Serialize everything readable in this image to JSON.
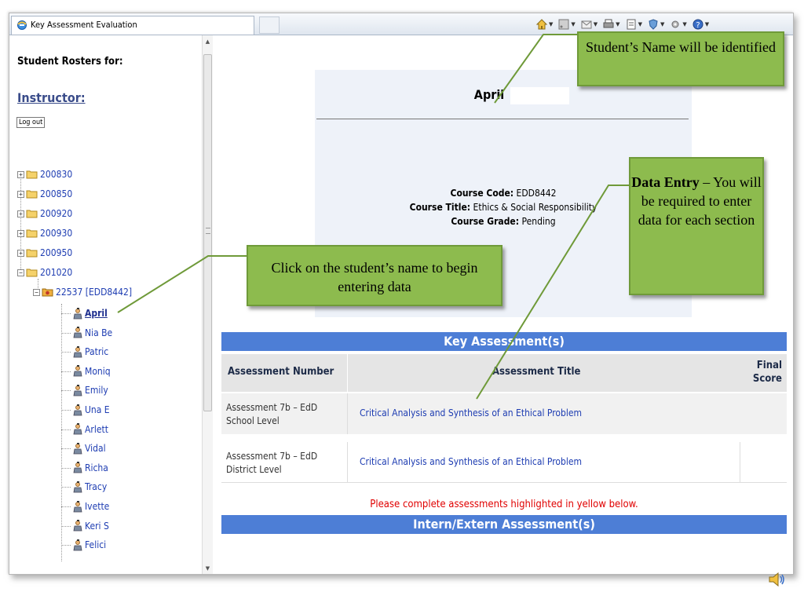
{
  "browser": {
    "tab_title": "Key Assessment Evaluation",
    "toolbar_icons": [
      "home-icon",
      "feeds-icon",
      "mail-icon",
      "print-icon",
      "page-icon",
      "safety-icon",
      "tools-icon",
      "help-icon"
    ]
  },
  "sidebar": {
    "title": "Student Rosters for:",
    "instructor_label": "Instructor:",
    "logout_label": "Log out",
    "terms": [
      {
        "label": "200830",
        "toggle": "+"
      },
      {
        "label": "200850",
        "toggle": "+"
      },
      {
        "label": "200920",
        "toggle": "+"
      },
      {
        "label": "200930",
        "toggle": "+"
      },
      {
        "label": "200950",
        "toggle": "+"
      },
      {
        "label": "201020",
        "toggle": "−"
      }
    ],
    "course": {
      "label": "22537 [EDD8442]",
      "toggle": "−"
    },
    "students": [
      "April",
      "Nia Be",
      "Patric",
      "Moniq",
      "Emily",
      "Una E",
      "Arlett",
      "Vidal",
      "Richa",
      "Tracy",
      "Ivette",
      "Keri S",
      "Felici"
    ]
  },
  "main": {
    "student_name": "April",
    "course_code_label": "Course Code:",
    "course_code": "EDD8442",
    "course_title_label": "Course Title:",
    "course_title": "Ethics & Social Responsibility",
    "course_grade_label": "Course Grade:",
    "course_grade": "Pending",
    "key_assessments_header": "Key Assessment(s)",
    "columns": [
      "Assessment Number",
      "Assessment Title",
      "Final Score"
    ],
    "rows": [
      {
        "number": "Assessment 7b – EdD School Level",
        "title": "Critical Analysis and Synthesis of an Ethical Problem",
        "score": ""
      },
      {
        "number": "Assessment 7b – EdD District Level",
        "title": "Critical Analysis and Synthesis of an Ethical Problem",
        "score": ""
      }
    ],
    "notice": "Please complete assessments highlighted in yellow below.",
    "intern_header": "Intern/Extern Assessment(s)"
  },
  "callouts": {
    "name": "Student’s Name will be identified",
    "click": "Click on the student’s name to begin entering data",
    "data_bold": "Data Entry",
    "data_rest": " – You will be required to enter data for each section"
  },
  "colors": {
    "callout_fill": "#8dbb4e",
    "callout_border": "#6f9a39",
    "section_header": "#4d7ed6",
    "link_blue": "#1e3db2",
    "notice_red": "#e00000"
  }
}
